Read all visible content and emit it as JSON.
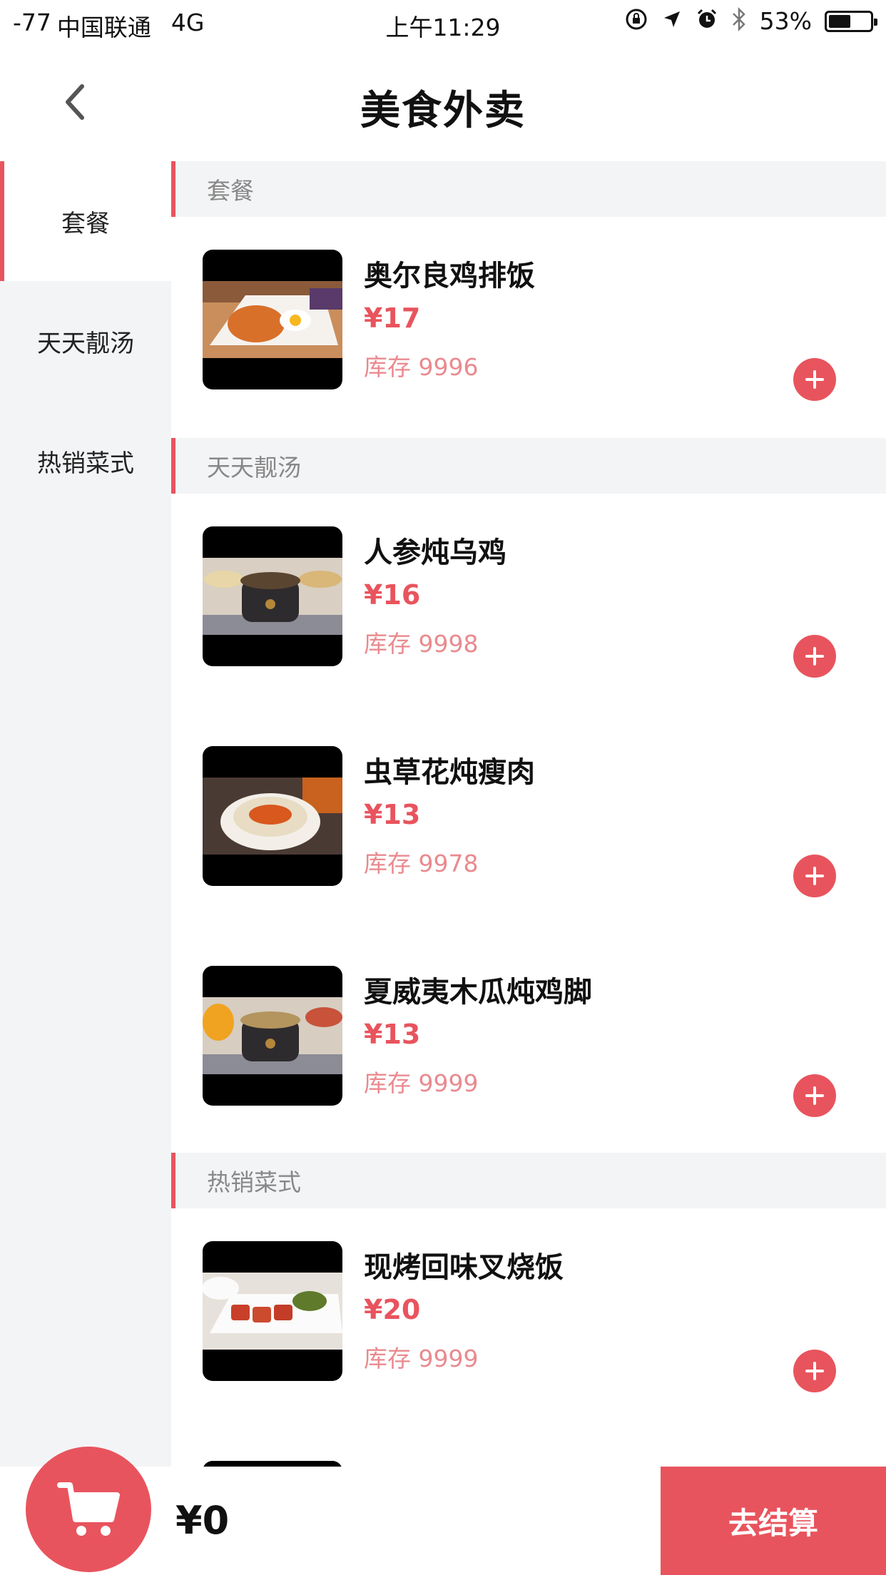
{
  "status_bar": {
    "signal": "-77",
    "carrier": "中国联通",
    "network": "4G",
    "time": "上午11:29",
    "battery": "53%",
    "battery_level": 0.53
  },
  "nav": {
    "title": "美食外卖"
  },
  "sidebar": {
    "items": [
      {
        "label": "套餐",
        "active": true
      },
      {
        "label": "天天靓汤",
        "active": false
      },
      {
        "label": "热销菜式",
        "active": false
      }
    ]
  },
  "sections": [
    {
      "header": "套餐",
      "items": [
        {
          "name": "奥尔良鸡排饭",
          "price": "¥17",
          "stock": "库存 9996",
          "image": "chicken-cutlet-rice"
        }
      ]
    },
    {
      "header": "天天靓汤",
      "items": [
        {
          "name": "人参炖乌鸡",
          "price": "¥16",
          "stock": "库存 9998",
          "image": "ginseng-chicken-soup"
        },
        {
          "name": "虫草花炖瘦肉",
          "price": "¥13",
          "stock": "库存 9978",
          "image": "cordyceps-pork-soup"
        },
        {
          "name": "夏威夷木瓜炖鸡脚",
          "price": "¥13",
          "stock": "库存 9999",
          "image": "papaya-chicken-feet-soup"
        }
      ]
    },
    {
      "header": "热销菜式",
      "items": [
        {
          "name": "现烤回味叉烧饭",
          "price": "¥20",
          "stock": "库存 9999",
          "image": "char-siu-rice"
        }
      ]
    }
  ],
  "bottom_bar": {
    "total": "¥0",
    "checkout_label": "去结算",
    "cart_icon": "shopping-cart-icon"
  },
  "colors": {
    "accent": "#e8545d",
    "stock_text": "#e98a8f",
    "sidebar_bg": "#f3f4f6",
    "section_header_text": "#888888"
  }
}
